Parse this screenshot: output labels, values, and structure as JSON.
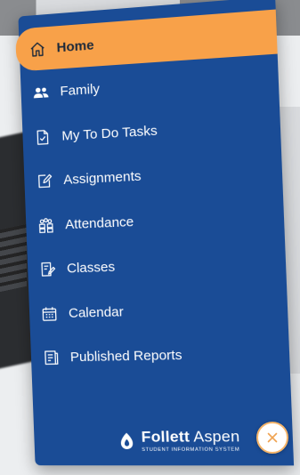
{
  "nav": {
    "items": [
      {
        "label": "Home",
        "icon": "home-icon",
        "active": true
      },
      {
        "label": "Family",
        "icon": "family-icon",
        "active": false
      },
      {
        "label": "My To Do Tasks",
        "icon": "todo-icon",
        "active": false
      },
      {
        "label": "Assignments",
        "icon": "assignments-icon",
        "active": false
      },
      {
        "label": "Attendance",
        "icon": "attendance-icon",
        "active": false
      },
      {
        "label": "Classes",
        "icon": "classes-icon",
        "active": false
      },
      {
        "label": "Calendar",
        "icon": "calendar-icon",
        "active": false
      },
      {
        "label": "Published Reports",
        "icon": "reports-icon",
        "active": false
      }
    ]
  },
  "brand": {
    "name_bold": "Follett",
    "name_regular": "Aspen",
    "tagline": "STUDENT INFORMATION SYSTEM"
  },
  "colors": {
    "drawer": "#1a4c96",
    "active": "#f8a149",
    "close_ring": "#f4b46a"
  }
}
